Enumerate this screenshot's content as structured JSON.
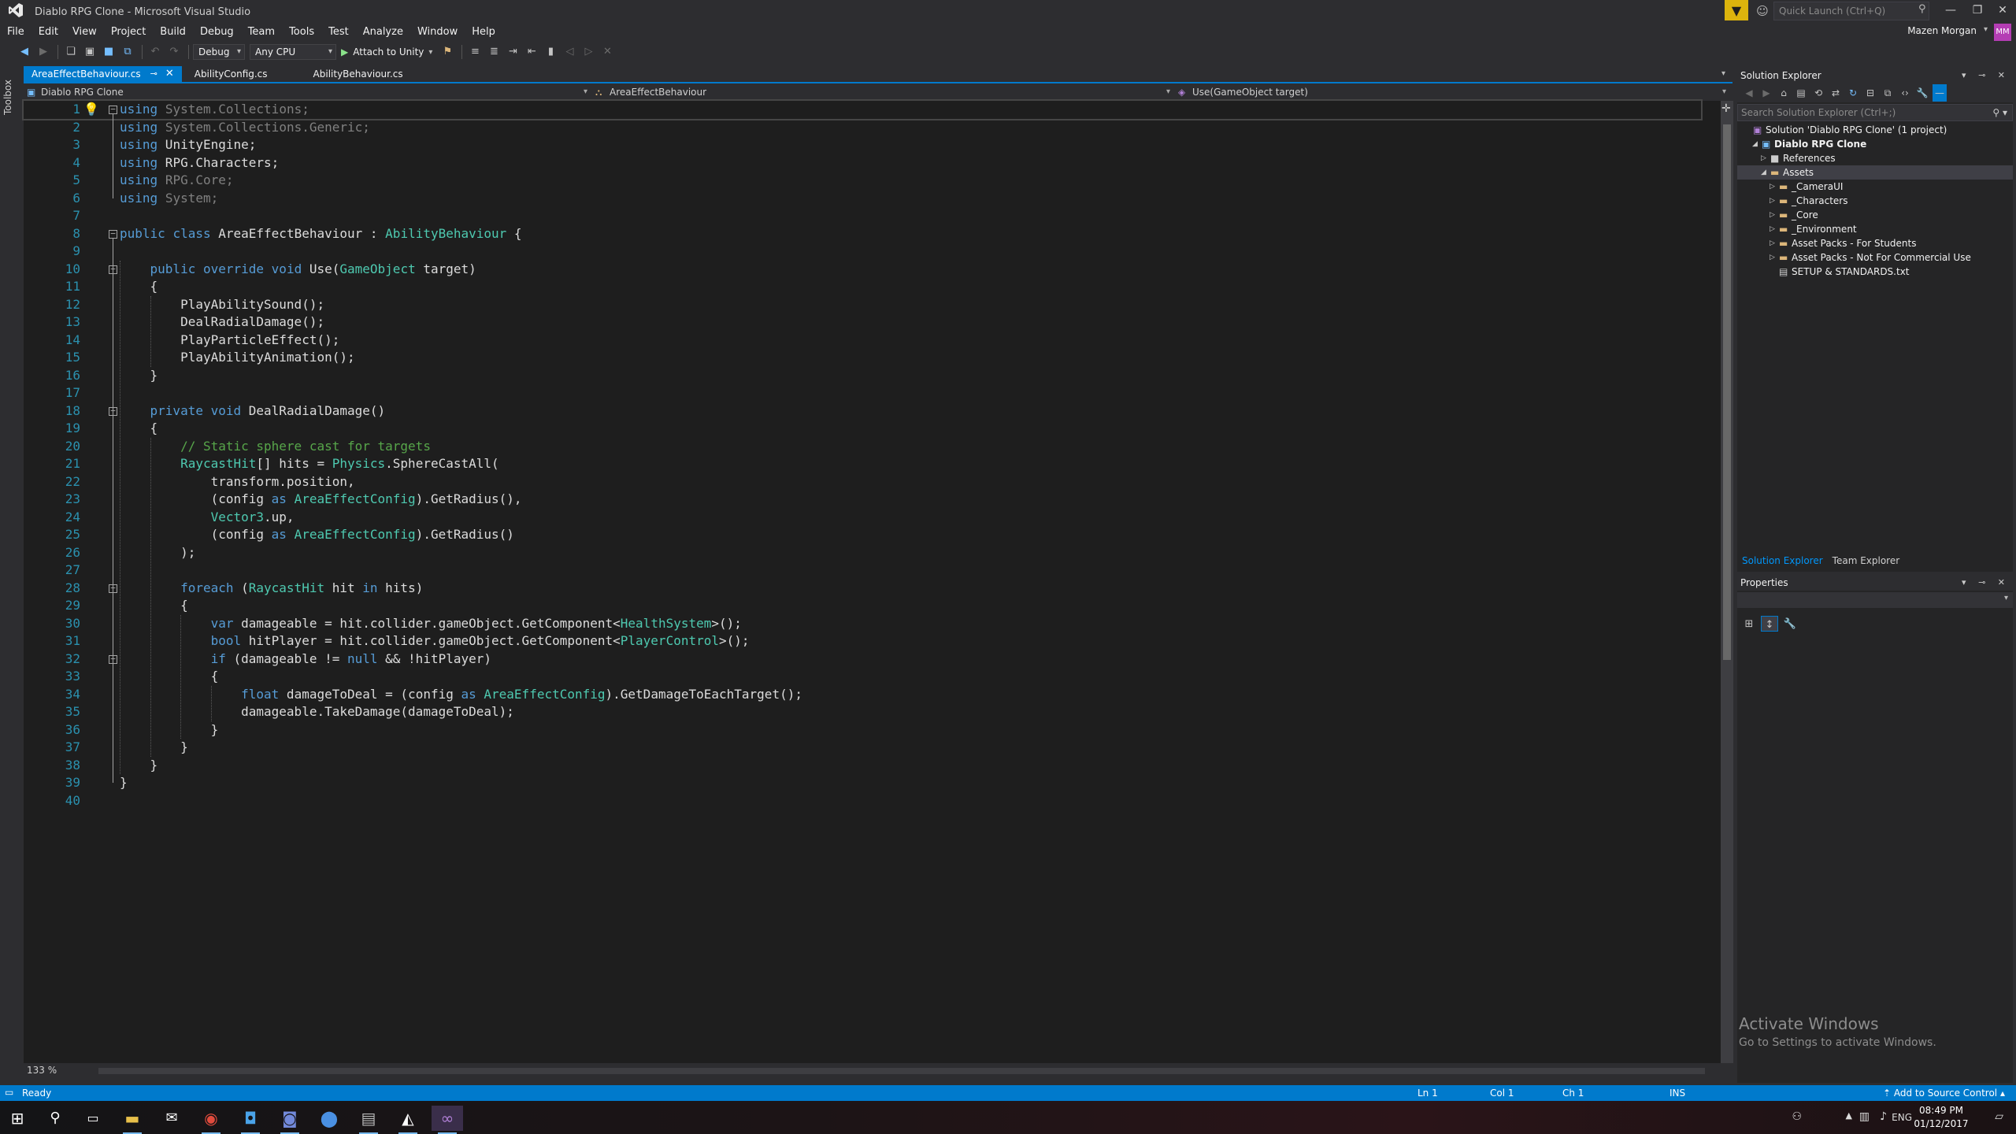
{
  "window": {
    "title": "Diablo RPG Clone - Microsoft Visual Studio",
    "quick_launch_placeholder": "Quick Launch (Ctrl+Q)",
    "user_name": "Mazen Morgan",
    "user_initials": "MM"
  },
  "menu": [
    "File",
    "Edit",
    "View",
    "Project",
    "Build",
    "Debug",
    "Team",
    "Tools",
    "Test",
    "Analyze",
    "Window",
    "Help"
  ],
  "toolbar": {
    "configuration": "Debug",
    "platform": "Any CPU",
    "attach_label": "Attach to Unity"
  },
  "toolbox_label": "Toolbox",
  "tabs": [
    {
      "label": "AreaEffectBehaviour.cs",
      "active": true
    },
    {
      "label": "AbilityConfig.cs",
      "active": false
    },
    {
      "label": "AbilityBehaviour.cs",
      "active": false
    }
  ],
  "navbar": {
    "project": "Diablo RPG Clone",
    "class": "AreaEffectBehaviour",
    "member": "Use(GameObject target)"
  },
  "code": {
    "lines": [
      "using System.Collections;",
      "using System.Collections.Generic;",
      "using UnityEngine;",
      "using RPG.Characters;",
      "using RPG.Core;",
      "using System;",
      "",
      "public class AreaEffectBehaviour : AbilityBehaviour {",
      "",
      "    public override void Use(GameObject target)",
      "    {",
      "        PlayAbilitySound();",
      "        DealRadialDamage();",
      "        PlayParticleEffect();",
      "        PlayAbilityAnimation();",
      "    }",
      "",
      "    private void DealRadialDamage()",
      "    {",
      "        // Static sphere cast for targets",
      "        RaycastHit[] hits = Physics.SphereCastAll(",
      "            transform.position,",
      "            (config as AreaEffectConfig).GetRadius(),",
      "            Vector3.up,",
      "            (config as AreaEffectConfig).GetRadius()",
      "        );",
      "",
      "        foreach (RaycastHit hit in hits)",
      "        {",
      "            var damageable = hit.collider.gameObject.GetComponent<HealthSystem>();",
      "            bool hitPlayer = hit.collider.gameObject.GetComponent<PlayerControl>();",
      "            if (damageable != null && !hitPlayer)",
      "            {",
      "                float damageToDeal = (config as AreaEffectConfig).GetDamageToEachTarget();",
      "                damageable.TakeDamage(damageToDeal);",
      "            }",
      "        }",
      "    }",
      "}",
      ""
    ],
    "zoom": "133 %"
  },
  "solution_explorer": {
    "title": "Solution Explorer",
    "search_placeholder": "Search Solution Explorer (Ctrl+;)",
    "items": [
      {
        "label": "Solution 'Diablo RPG Clone' (1 project)",
        "depth": 0,
        "arrow": "",
        "icon": "solution"
      },
      {
        "label": "Diablo RPG Clone",
        "depth": 1,
        "arrow": "◢",
        "icon": "project"
      },
      {
        "label": "References",
        "depth": 2,
        "arrow": "▷",
        "icon": "references"
      },
      {
        "label": "Assets",
        "depth": 2,
        "arrow": "◢",
        "icon": "folder-open"
      },
      {
        "label": "_CameraUI",
        "depth": 3,
        "arrow": "▷",
        "icon": "folder"
      },
      {
        "label": "_Characters",
        "depth": 3,
        "arrow": "▷",
        "icon": "folder"
      },
      {
        "label": "_Core",
        "depth": 3,
        "arrow": "▷",
        "icon": "folder"
      },
      {
        "label": "_Environment",
        "depth": 3,
        "arrow": "▷",
        "icon": "folder"
      },
      {
        "label": "Asset Packs - For Students",
        "depth": 3,
        "arrow": "▷",
        "icon": "folder"
      },
      {
        "label": "Asset Packs - Not For Commercial Use",
        "depth": 3,
        "arrow": "▷",
        "icon": "folder"
      },
      {
        "label": "SETUP & STANDARDS.txt",
        "depth": 3,
        "arrow": "",
        "icon": "file"
      }
    ],
    "bottom_tabs": [
      "Solution Explorer",
      "Team Explorer"
    ]
  },
  "properties": {
    "title": "Properties"
  },
  "activation": {
    "title": "Activate Windows",
    "subtitle": "Go to Settings to activate Windows."
  },
  "status": {
    "ready": "Ready",
    "line": "Ln 1",
    "col": "Col 1",
    "ch": "Ch 1",
    "mode": "INS",
    "source_control": "Add to Source Control"
  },
  "taskbar": {
    "language": "ENG",
    "time": "08:49 PM",
    "date": "01/12/2017"
  },
  "colors": {
    "accent": "#007acc",
    "keyword": "#569cd6",
    "type": "#4ec9b0",
    "comment": "#57a64a",
    "line_number": "#2b91af",
    "editor_bg": "#1e1e1e"
  }
}
